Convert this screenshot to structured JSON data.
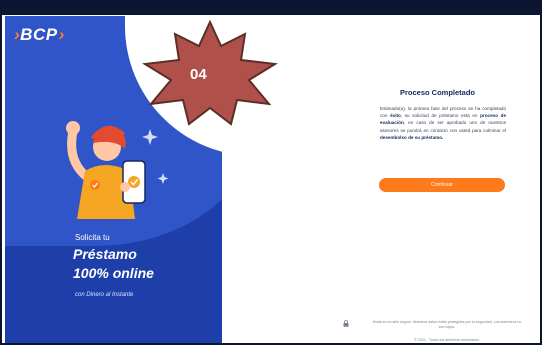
{
  "brand": {
    "logo_text": "BCP"
  },
  "left_panel": {
    "lead": "Solicita tu",
    "title_line1": "Préstamo",
    "title_line2": "100% online",
    "subtitle": "con Dinero al Instante"
  },
  "badge": {
    "number": "04",
    "color": "#b0504b"
  },
  "main": {
    "title": "Proceso Completado",
    "message_intro": "Estimado(a), la primera fase del proceso se ha completado con",
    "message_highlight1": "éxito",
    "message_mid": ", su solicitud de préstamo está en",
    "message_highlight2": "proceso de evaluación",
    "message_mid2": ", en caso de ser aprobado uno de nuestros asesores se pondrá en contacto con usted para culminar el",
    "message_highlight3": "desembolso de su préstamo.",
    "continue_label": "Continuar"
  },
  "footer": {
    "icon": "lock-icon",
    "line1": "Estás en un sitio seguro. Nuestros datos están protegidos por tu seguridad. Los anteriores no son tuyos.",
    "line2": "© 2021 - Todos los derechos reservados."
  },
  "colors": {
    "primary": "#1e3faa",
    "accent": "#ff7a1a",
    "heading": "#13285f"
  }
}
